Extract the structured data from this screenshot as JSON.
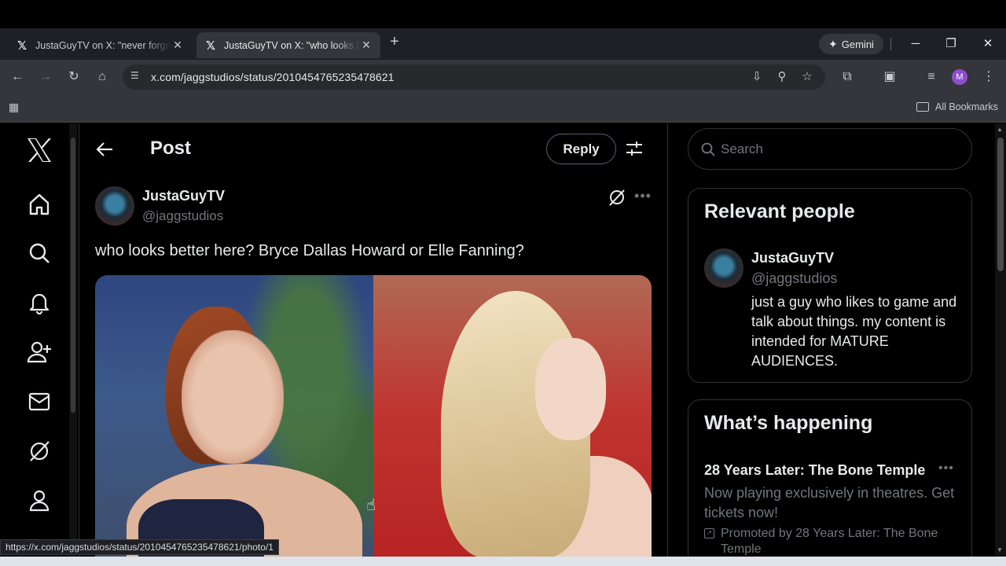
{
  "browser": {
    "tabs": [
      {
        "title": "JustaGuyTV on X: \"never forget",
        "active": false
      },
      {
        "title": "JustaGuyTV on X: \"who looks be",
        "active": true
      }
    ],
    "gemini_label": "Gemini",
    "url": "x.com/jaggstudios/status/2010454765235478621",
    "profile_initial": "M",
    "bookmarks_label": "All Bookmarks",
    "status_url": "https://x.com/jaggstudios/status/2010454765235478621/photo/1"
  },
  "header": {
    "title": "Post",
    "reply_label": "Reply"
  },
  "post": {
    "author_name": "JustaGuyTV",
    "author_handle": "@jaggstudios",
    "text": "who looks better here? Bryce Dallas Howard or Elle Fanning?"
  },
  "search": {
    "placeholder": "Search"
  },
  "relevant_people": {
    "title": "Relevant people",
    "name": "JustaGuyTV",
    "handle": "@jaggstudios",
    "bio": "just a guy who likes to game and talk about things. my content is intended for MATURE AUDIENCES."
  },
  "whats_happening": {
    "title": "What’s happening",
    "trend_title": "28 Years Later: The Bone Temple",
    "trend_desc": "Now playing exclusively in theatres. Get tickets now!",
    "promoted": "Promoted by 28 Years Later: The Bone Temple"
  },
  "colors": {
    "background": "#000000",
    "text": "#e7e9ea",
    "muted": "#71767b",
    "border": "#2f3336"
  }
}
